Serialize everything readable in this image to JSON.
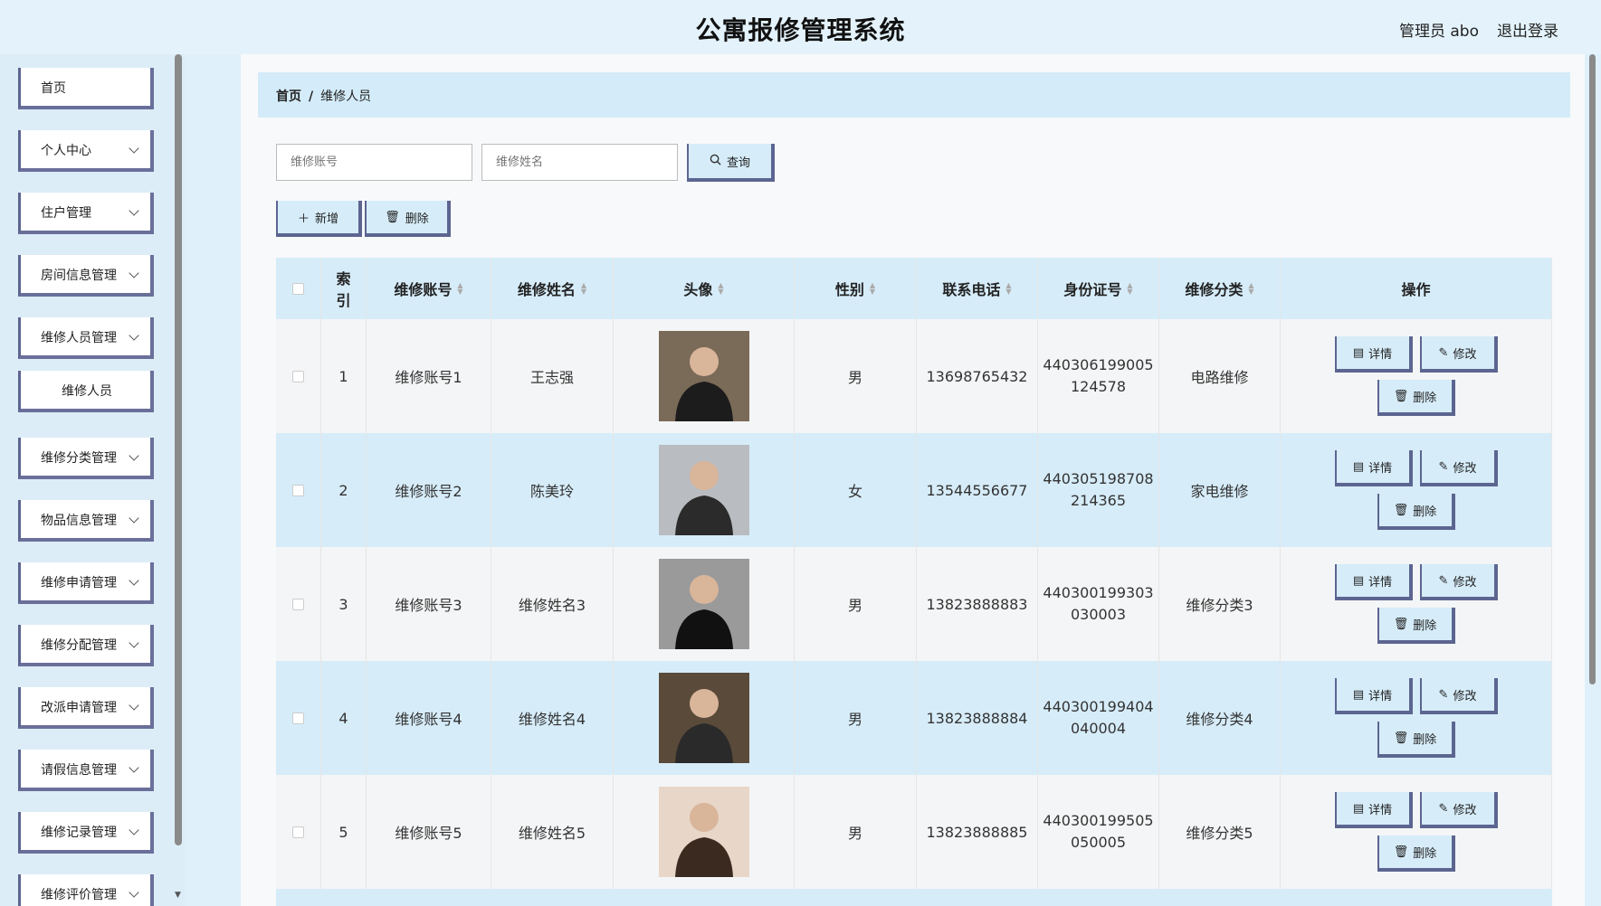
{
  "header": {
    "title": "公寓报修管理系统",
    "user": "管理员 abo",
    "logout": "退出登录"
  },
  "sidebar": {
    "items": [
      {
        "label": "首页",
        "has_chevron": false
      },
      {
        "label": "个人中心",
        "has_chevron": true
      },
      {
        "label": "住户管理",
        "has_chevron": true
      },
      {
        "label": "房间信息管理",
        "has_chevron": true
      },
      {
        "label": "维修人员管理",
        "has_chevron": true
      },
      {
        "label": "维修人员",
        "has_chevron": false,
        "sub": true
      },
      {
        "label": "维修分类管理",
        "has_chevron": true
      },
      {
        "label": "物品信息管理",
        "has_chevron": true
      },
      {
        "label": "维修申请管理",
        "has_chevron": true
      },
      {
        "label": "维修分配管理",
        "has_chevron": true
      },
      {
        "label": "改派申请管理",
        "has_chevron": true
      },
      {
        "label": "请假信息管理",
        "has_chevron": true
      },
      {
        "label": "维修记录管理",
        "has_chevron": true
      },
      {
        "label": "维修评价管理",
        "has_chevron": true
      }
    ]
  },
  "breadcrumb": {
    "home": "首页",
    "sep": "/",
    "current": "维修人员"
  },
  "search": {
    "account_placeholder": "维修账号",
    "name_placeholder": "维修姓名",
    "query_label": "查询"
  },
  "actions": {
    "add_label": "新增",
    "delete_label": "删除"
  },
  "table": {
    "headers": [
      "索引",
      "维修账号",
      "维修姓名",
      "头像",
      "性别",
      "联系电话",
      "身份证号",
      "维修分类",
      "操作"
    ],
    "ops": {
      "detail": "详情",
      "edit": "修改",
      "delete": "删除"
    },
    "rows": [
      {
        "index": "1",
        "account": "维修账号1",
        "name": "王志强",
        "gender": "男",
        "phone": "13698765432",
        "id1": "440306199005",
        "id2": "124578",
        "category": "电路维修"
      },
      {
        "index": "2",
        "account": "维修账号2",
        "name": "陈美玲",
        "gender": "女",
        "phone": "13544556677",
        "id1": "440305198708",
        "id2": "214365",
        "category": "家电维修"
      },
      {
        "index": "3",
        "account": "维修账号3",
        "name": "维修姓名3",
        "gender": "男",
        "phone": "13823888883",
        "id1": "440300199303",
        "id2": "030003",
        "category": "维修分类3"
      },
      {
        "index": "4",
        "account": "维修账号4",
        "name": "维修姓名4",
        "gender": "男",
        "phone": "13823888884",
        "id1": "440300199404",
        "id2": "040004",
        "category": "维修分类4"
      },
      {
        "index": "5",
        "account": "维修账号5",
        "name": "维修姓名5",
        "gender": "男",
        "phone": "13823888885",
        "id1": "440300199505",
        "id2": "050005",
        "category": "维修分类5"
      }
    ]
  },
  "colors": {
    "accent": "#5c6590",
    "row_alt": "#d6ecf9",
    "header_bg": "#e4f3fb"
  }
}
